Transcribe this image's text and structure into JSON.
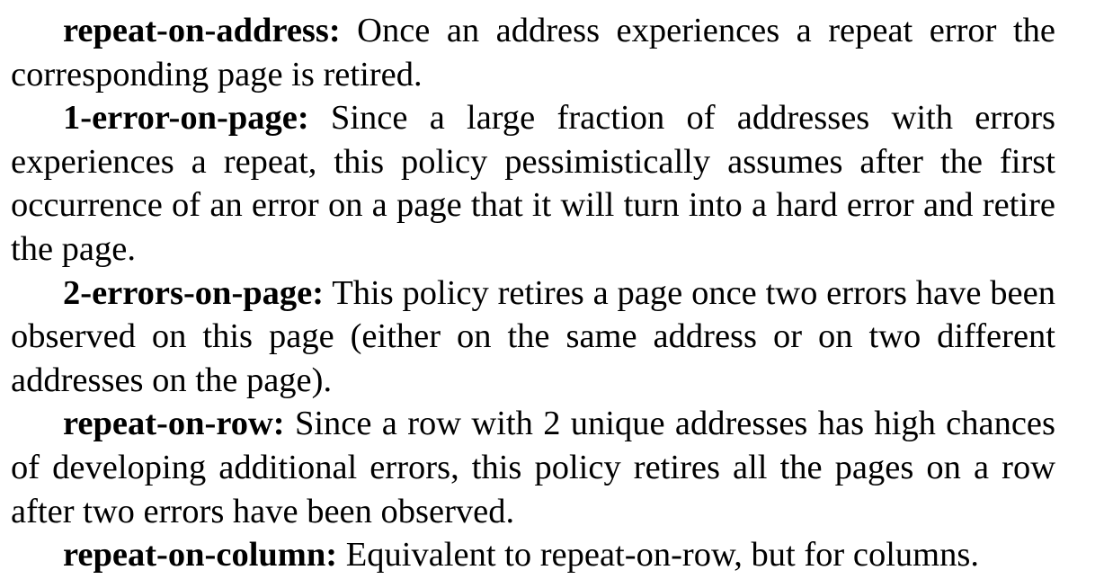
{
  "policies": [
    {
      "term": "repeat-on-address:",
      "text": " Once an address experiences a repeat error the corresponding page is retired."
    },
    {
      "term": "1-error-on-page:",
      "text": " Since a large fraction of addresses with errors experiences a repeat, this policy pessimistically assumes after the first occurrence of an error on a page that it will turn into a hard error and retire the page."
    },
    {
      "term": "2-errors-on-page:",
      "text": " This policy retires a page once two errors have been observed on this page (either on the same address or on two different addresses on the page)."
    },
    {
      "term": "repeat-on-row:",
      "text": " Since a row with 2 unique addresses has high chances of developing additional errors, this policy retires all the pages on a row after two errors have been observed."
    },
    {
      "term": "repeat-on-column:",
      "text": " Equivalent to repeat-on-row, but for columns."
    }
  ]
}
